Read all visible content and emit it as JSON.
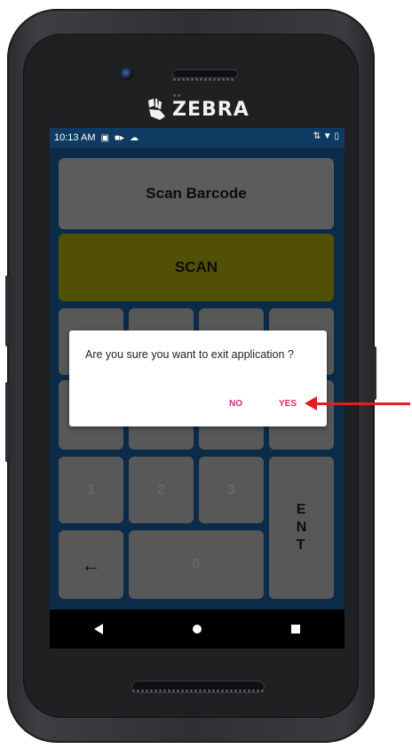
{
  "device": {
    "brand": "ZEBRA"
  },
  "statusbar": {
    "time": "10:13 AM"
  },
  "app": {
    "scan_barcode_label": "Scan Barcode",
    "scan_label": "SCAN",
    "keypad": {
      "k1": "1",
      "k2": "2",
      "k3": "3",
      "k0": "0",
      "ent": "E\nN\nT",
      "back": "←"
    }
  },
  "dialog": {
    "message": "Are you sure you want to exit application ?",
    "no_label": "NO",
    "yes_label": "YES"
  },
  "colors": {
    "screen_bg": "#0f3a61",
    "button_gray": "#7b7b7b",
    "scan_button": "#6e6b07",
    "dialog_action": "#d8287a",
    "annotation_arrow": "#e01f1f"
  }
}
